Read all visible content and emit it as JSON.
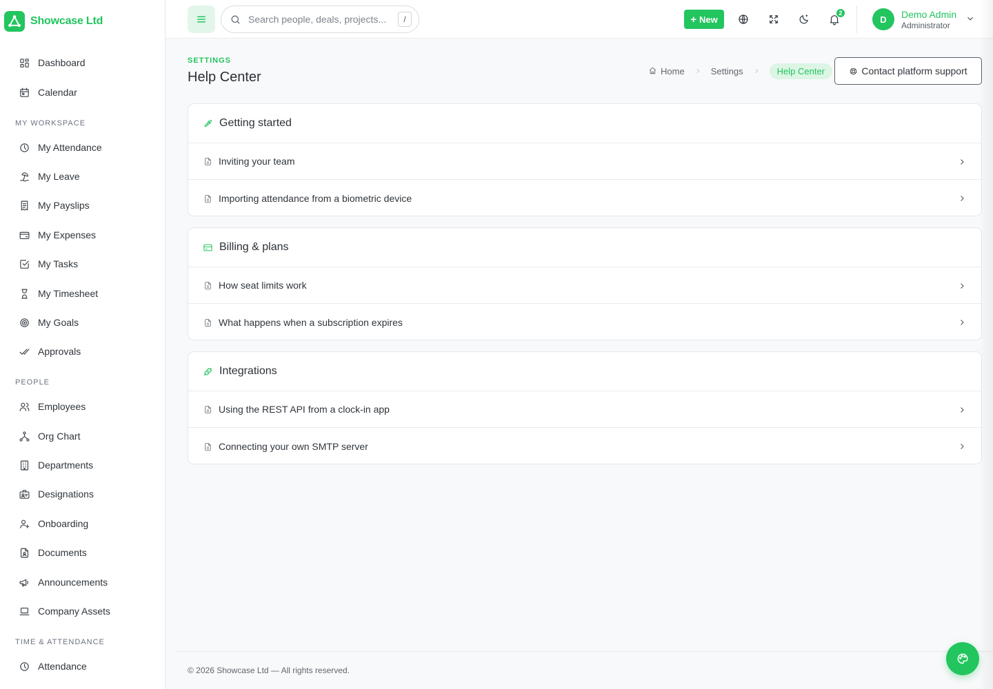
{
  "brand": {
    "name": "Showcase Ltd"
  },
  "sidebar": {
    "items": [
      {
        "label": "Dashboard",
        "icon": "dashboard-icon"
      },
      {
        "label": "Calendar",
        "icon": "calendar-icon"
      }
    ],
    "sections": [
      {
        "title": "MY WORKSPACE",
        "items": [
          {
            "label": "My Attendance",
            "icon": "clock-icon"
          },
          {
            "label": "My Leave",
            "icon": "beach-icon"
          },
          {
            "label": "My Payslips",
            "icon": "receipt-icon"
          },
          {
            "label": "My Expenses",
            "icon": "wallet-icon"
          },
          {
            "label": "My Tasks",
            "icon": "checkbox-icon"
          },
          {
            "label": "My Timesheet",
            "icon": "hourglass-icon"
          },
          {
            "label": "My Goals",
            "icon": "target-icon"
          },
          {
            "label": "Approvals",
            "icon": "double-check-icon"
          }
        ]
      },
      {
        "title": "PEOPLE",
        "items": [
          {
            "label": "Employees",
            "icon": "users-icon"
          },
          {
            "label": "Org Chart",
            "icon": "hierarchy-icon"
          },
          {
            "label": "Departments",
            "icon": "building-icon"
          },
          {
            "label": "Designations",
            "icon": "id-badge-icon"
          },
          {
            "label": "Onboarding",
            "icon": "user-plus-icon"
          },
          {
            "label": "Documents",
            "icon": "file-user-icon"
          },
          {
            "label": "Announcements",
            "icon": "megaphone-icon"
          },
          {
            "label": "Company Assets",
            "icon": "laptop-icon"
          }
        ]
      },
      {
        "title": "TIME & ATTENDANCE",
        "items": [
          {
            "label": "Attendance",
            "icon": "clock-icon"
          }
        ]
      }
    ]
  },
  "header": {
    "search_placeholder": "Search people, deals, projects...",
    "search_shortcut": "/",
    "new_label": "New",
    "notifications_count": "2",
    "user": {
      "initial": "D",
      "name": "Demo Admin",
      "role": "Administrator"
    }
  },
  "page": {
    "kicker": "SETTINGS",
    "title": "Help Center",
    "breadcrumb": [
      "Home",
      "Settings",
      "Help Center"
    ],
    "support_label": "Contact platform support"
  },
  "categories": [
    {
      "title": "Getting started",
      "icon": "rocket-icon",
      "articles": [
        "Inviting your team",
        "Importing attendance from a biometric device"
      ]
    },
    {
      "title": "Billing & plans",
      "icon": "credit-card-icon",
      "articles": [
        "How seat limits work",
        "What happens when a subscription expires"
      ]
    },
    {
      "title": "Integrations",
      "icon": "plug-icon",
      "articles": [
        "Using the REST API from a clock-in app",
        "Connecting your own SMTP server"
      ]
    }
  ],
  "footer": {
    "text": "© 2026 Showcase Ltd — All rights reserved."
  },
  "colors": {
    "accent": "#22c55e",
    "accent_soft": "#dcf5e5",
    "text": "#2b3036",
    "border": "#e4e7eb"
  }
}
